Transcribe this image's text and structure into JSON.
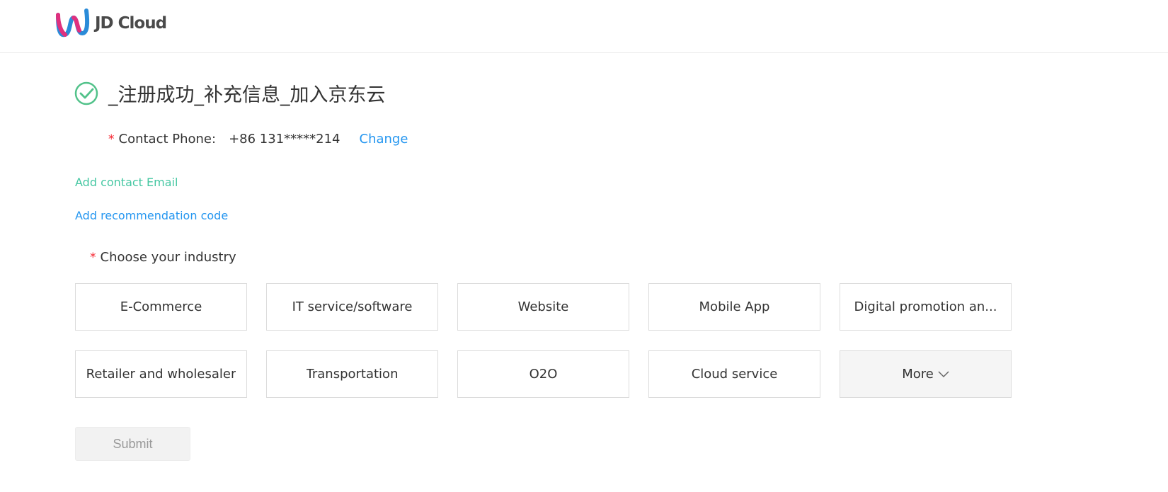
{
  "header": {
    "logo_text": "JD Cloud"
  },
  "title": "_注册成功_补充信息_加入京东云",
  "phone": {
    "required_mark": "*",
    "label": "Contact Phone:",
    "value": "+86 131*****214",
    "change_label": "Change"
  },
  "links": {
    "add_email": "Add contact Email",
    "add_recommendation": "Add recommendation code"
  },
  "industry": {
    "required_mark": "*",
    "label": "Choose your industry",
    "options": [
      "E-Commerce",
      "IT service/software",
      "Website",
      "Mobile App",
      "Digital promotion an...",
      "Retailer and wholesaler",
      "Transportation",
      "O2O",
      "Cloud service",
      "More"
    ]
  },
  "submit_label": "Submit",
  "colors": {
    "accent_blue": "#2496f0",
    "accent_green": "#45c7a2",
    "success_icon": "#52c28a",
    "required": "#f5222d"
  },
  "icons": {
    "logo": "jd-cloud-logo-icon",
    "success": "check-circle-icon",
    "more": "chevron-down-icon"
  }
}
